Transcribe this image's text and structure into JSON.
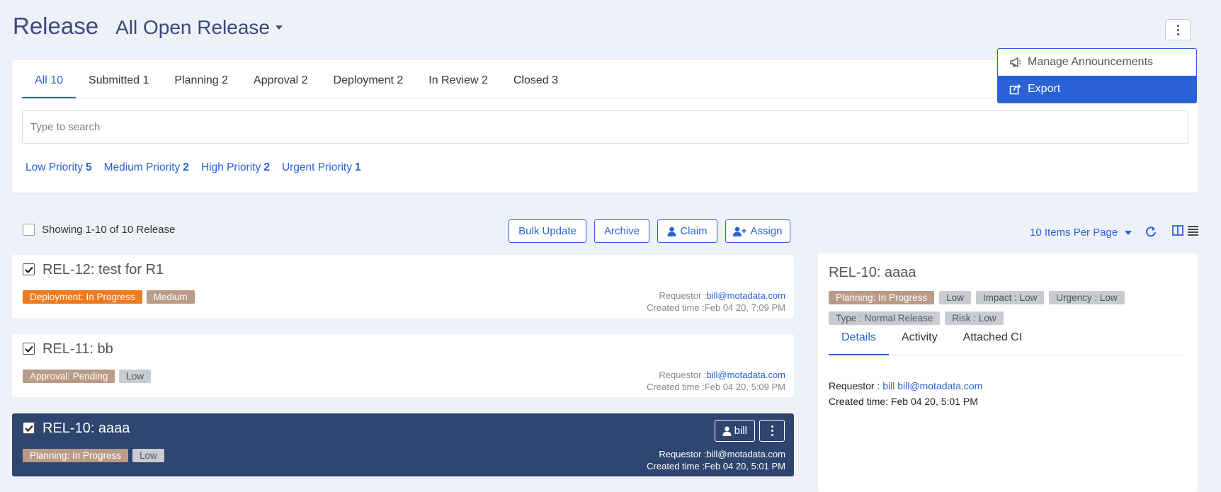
{
  "header": {
    "title": "Release",
    "view": "All Open Release"
  },
  "menu": {
    "items": [
      "Manage Announcements",
      "Export"
    ],
    "active_index": 1
  },
  "tabs": [
    {
      "label": "All 10"
    },
    {
      "label": "Submitted 1"
    },
    {
      "label": "Planning 2"
    },
    {
      "label": "Approval 2"
    },
    {
      "label": "Deployment 2"
    },
    {
      "label": "In Review 2"
    },
    {
      "label": "Closed 3"
    }
  ],
  "search": {
    "placeholder": "Type to search"
  },
  "priorities": [
    {
      "label": "Low Priority",
      "count": "5"
    },
    {
      "label": "Medium Priority",
      "count": "2"
    },
    {
      "label": "High Priority",
      "count": "2"
    },
    {
      "label": "Urgent Priority",
      "count": "1"
    }
  ],
  "toolbar": {
    "showing": "Showing 1-10 of 10 Release",
    "bulk_update": "Bulk Update",
    "archive": "Archive",
    "claim": "Claim",
    "assign": "Assign",
    "per_page": "10 Items Per Page"
  },
  "releases": [
    {
      "title": "REL-12: test for R1",
      "tags": [
        "Deployment: In Progress",
        "Medium"
      ],
      "requestor_label": "Requestor :",
      "requestor": "bill@motadata.com",
      "created": "Created time :Feb 04 20, 7:09 PM"
    },
    {
      "title": "REL-11: bb",
      "tags": [
        "Approval: Pending",
        "Low"
      ],
      "requestor_label": "Requestor :",
      "requestor": "bill@motadata.com",
      "created": "Created time :Feb 04 20, 5:09 PM"
    },
    {
      "title": "REL-10: aaaa",
      "tags": [
        "Planning: In Progress",
        "Low"
      ],
      "requestor_label": "Requestor :",
      "requestor": "bill@motadata.com",
      "created": "Created time :Feb 04 20, 5:01 PM",
      "assignee": "bill"
    }
  ],
  "detail": {
    "title": "REL-10: aaaa",
    "tags": [
      "Planning: In Progress",
      "Low",
      "Impact : Low",
      "Urgency : Low",
      "Type : Normal Release",
      "Risk : Low"
    ],
    "tabs": [
      "Details",
      "Activity",
      "Attached CI"
    ],
    "requestor_label": "Requestor :",
    "requestor": "bill bill@motadata.com",
    "created": "Created time: Feb 04 20, 5:01 PM"
  },
  "colors": {
    "accent": "#2a62d6",
    "selected_card": "#2e4570",
    "deployment_tag": "#ee7a1f",
    "status_tag": "#b99b87",
    "priority_tag": "#c8ccd1"
  },
  "icons": [
    "chevron-down-icon",
    "kebab-icon",
    "megaphone-icon",
    "export-icon",
    "user-icon",
    "user-plus-icon",
    "refresh-icon",
    "split-view-icon",
    "list-view-icon",
    "check-icon"
  ]
}
